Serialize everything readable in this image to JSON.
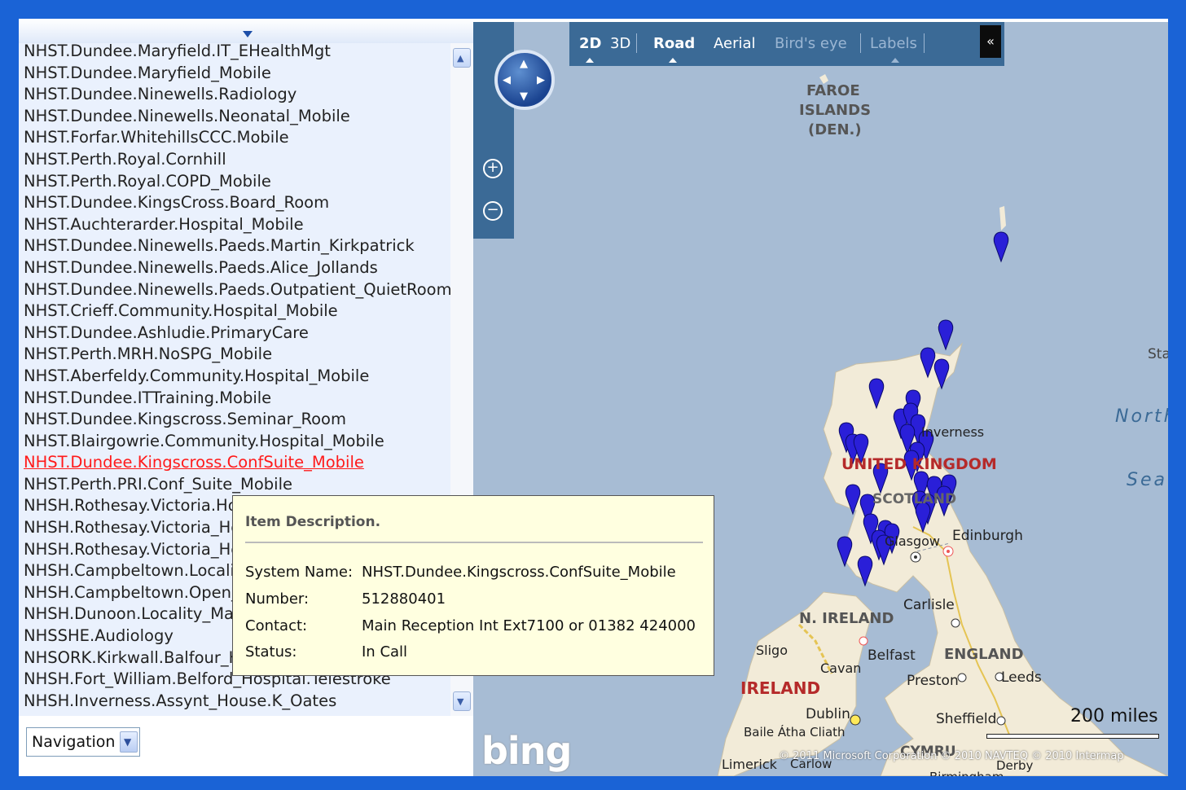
{
  "list": {
    "selected_index": 20,
    "items": [
      "NHST.Dundee.Maryfield.IT_EHealthMgt",
      "NHST.Dundee.Maryfield_Mobile",
      "NHST.Dundee.Ninewells.Radiology",
      "NHST.Dundee.Ninewells.Neonatal_Mobile",
      "NHST.Forfar.WhitehillsCCC.Mobile",
      "NHST.Perth.Royal.Cornhill",
      "NHST.Perth.Royal.COPD_Mobile",
      "NHST.Dundee.KingsCross.Board_Room",
      "NHST.Auchterarder.Hospital_Mobile",
      "NHST.Dundee.Ninewells.Paeds.Martin_Kirkpatrick",
      "NHST.Dundee.Ninewells.Paeds.Alice_Jollands",
      "NHST.Dundee.Ninewells.Paeds.Outpatient_QuietRoom",
      "NHST.Crieff.Community.Hospital_Mobile",
      "NHST.Dundee.Ashludie.PrimaryCare",
      "NHST.Perth.MRH.NoSPG_Mobile",
      "NHST.Aberfeldy.Community.Hospital_Mobile",
      "NHST.Dundee.ITTraining.Mobile",
      "NHST.Dundee.Kingscross.Seminar_Room",
      "NHST.Blairgowrie.Community.Hospital_Mobile",
      "NHST.Dundee.Kingscross.ConfSuite_Mobile",
      "NHST.Perth.PRI.Conf_Suite_Mobile",
      "NHSH.Rothesay.Victoria.Ho",
      "NHSH.Rothesay.Victoria_Ho",
      "NHSH.Rothesay.Victoria_Ho",
      "NHSH.Campbeltown.Localit",
      "NHSH.Campbeltown.Open_",
      "NHSH.Dunoon.Locality_Mar",
      "NHSSHE.Audiology",
      "NHSORK.Kirkwall.Balfour_H",
      "NHSH.Fort_William.Belford_Hospital.Telestroke",
      "NHSH.Inverness.Assynt_House.K_Oates"
    ]
  },
  "navigation_select": {
    "value": "Navigation"
  },
  "map": {
    "toolbar": {
      "view_2d": "2D",
      "view_3d": "3D",
      "road": "Road",
      "aerial": "Aerial",
      "birds_eye": "Bird's eye",
      "labels": "Labels",
      "collapse": "«"
    },
    "labels": {
      "faroe_1": "FAROE",
      "faroe_2": "ISLANDS",
      "faroe_3": "(DEN.)",
      "inverness": "Inverness",
      "united_kingdom": "UNITED KINGDOM",
      "scotland": "SCOTLAND",
      "glasgow": "Glasgow",
      "edinburgh": "Edinburgh",
      "carlisle": "Carlisle",
      "n_ireland": "N. IRELAND",
      "sligo": "Sligo",
      "belfast": "Belfast",
      "england": "ENGLAND",
      "preston": "Preston",
      "leeds": "Leeds",
      "cavan": "Cavan",
      "ireland": "IRELAND",
      "dublin": "Dublin",
      "baile_atha_cliath": "Baile Átha Cliath",
      "sheffield": "Sheffield",
      "cymru": "CYMRU",
      "limerick": "Limerick",
      "carlow": "Carlow",
      "derby": "Derby",
      "birmingham": "Birmingham",
      "north_sea_1": "North",
      "north_sea_2": "Sea",
      "sta": "Sta"
    },
    "logo": "bing",
    "scale": "200 miles",
    "copyright": "© 2011 Microsoft Corporation  © 2010 NAVTEQ  © 2010 Intermap"
  },
  "tooltip": {
    "title": "Item Description.",
    "system_name_label": "System Name:",
    "system_name": "NHST.Dundee.Kingscross.ConfSuite_Mobile",
    "number_label": "Number:",
    "number": "512880401",
    "contact_label": "Contact:",
    "contact": "Main Reception Int Ext7100 or 01382 424000",
    "status_label": "Status:",
    "status": "In Call"
  }
}
